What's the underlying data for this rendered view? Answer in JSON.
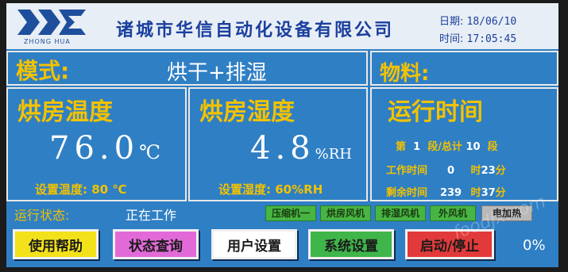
{
  "header": {
    "logo_text": "ZHONG HUA",
    "company": "诸城市华信自动化设备有限公司",
    "date_label": "日期:",
    "date_value": "18/06/10",
    "time_label": "时间:",
    "time_value": "17:05:45"
  },
  "mode": {
    "label": "模式:",
    "value": "烘干+排湿"
  },
  "material": {
    "label": "物料:"
  },
  "temperature": {
    "title": "烘房温度",
    "value": "76.0",
    "unit": "℃",
    "set_label": "设置温度:",
    "set_value": "80 ℃"
  },
  "humidity": {
    "title": "烘房湿度",
    "value": "4.8",
    "unit": "%RH",
    "set_label": "设置湿度:",
    "set_value": "60%RH"
  },
  "runtime": {
    "title": "运行时间",
    "seg_prefix": "第",
    "seg_current": "1",
    "seg_mid": "段/总计",
    "seg_total": "10",
    "seg_suffix": "段",
    "work_label": "工作时间",
    "work_hours": "0",
    "work_hour_unit": "时",
    "work_minutes": "23",
    "work_min_unit": "分",
    "remain_label": "剩余时间",
    "remain_hours": "239",
    "remain_hour_unit": "时",
    "remain_minutes": "37",
    "remain_min_unit": "分"
  },
  "status": {
    "label": "运行状态:",
    "value": "正在工作",
    "indicators": [
      {
        "label": "压缩机一",
        "state": "on"
      },
      {
        "label": "烘房风机",
        "state": "on"
      },
      {
        "label": "排湿风机",
        "state": "on"
      },
      {
        "label": "外风机",
        "state": "on"
      },
      {
        "label": "电加热",
        "state": "off"
      }
    ]
  },
  "buttons": {
    "help": "使用帮助",
    "status_query": "状态查询",
    "user_settings": "用户设置",
    "system_settings": "系统设置",
    "start_stop": "启动/停止"
  },
  "progress_text": "0%",
  "watermark": "foodjx.com",
  "colors": {
    "screen_bg": "#2f7fc4",
    "label_yellow": "#f2c200",
    "indicator_on": "#46b544",
    "btn_help": "#f3e21b",
    "btn_status": "#e26ad8",
    "btn_user": "#ffffff",
    "btn_system": "#3fb54a",
    "btn_start": "#e23a3a"
  }
}
